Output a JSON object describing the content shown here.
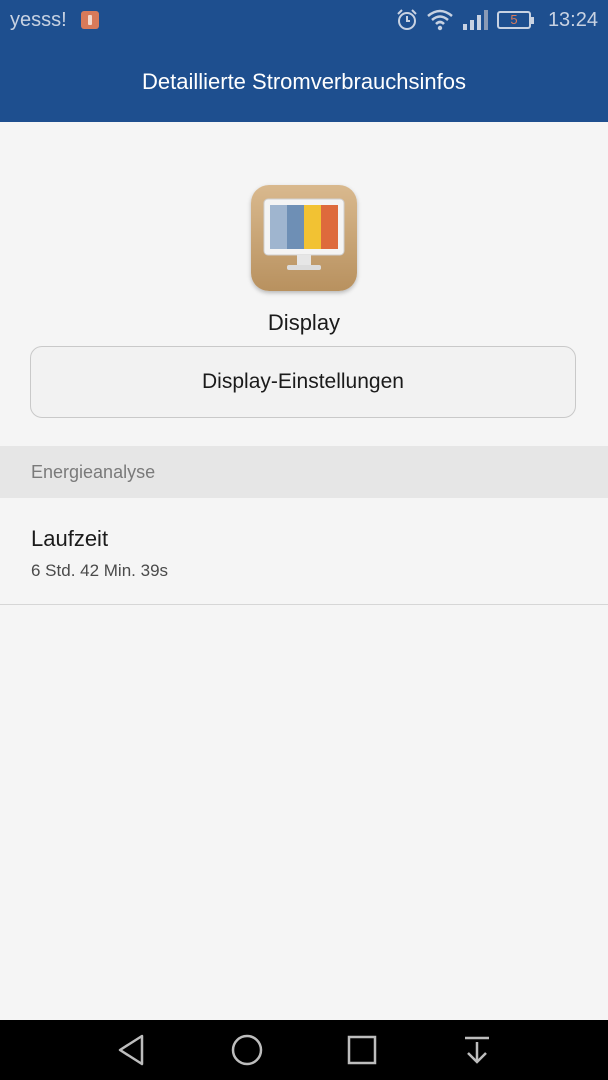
{
  "status_bar": {
    "carrier": "yesss!",
    "battery_level": "5",
    "time": "13:24",
    "icons": [
      "notification-icon",
      "alarm-icon",
      "wifi-icon",
      "signal-icon",
      "battery-icon"
    ]
  },
  "app_bar": {
    "title": "Detaillierte Stromverbrauchsinfos"
  },
  "app": {
    "icon": "display-monitor-icon",
    "name": "Display",
    "settings_button_label": "Display-Einstellungen"
  },
  "section": {
    "header": "Energieanalyse",
    "items": [
      {
        "title": "Laufzeit",
        "value": "6 Std. 42 Min. 39s"
      }
    ]
  },
  "nav_bar": {
    "buttons": [
      "back-icon",
      "home-icon",
      "recents-icon",
      "notification-shade-icon"
    ]
  },
  "colors": {
    "header_bg": "#1e4f8f",
    "page_bg": "#f5f5f5",
    "section_bg": "#e6e6e6"
  }
}
